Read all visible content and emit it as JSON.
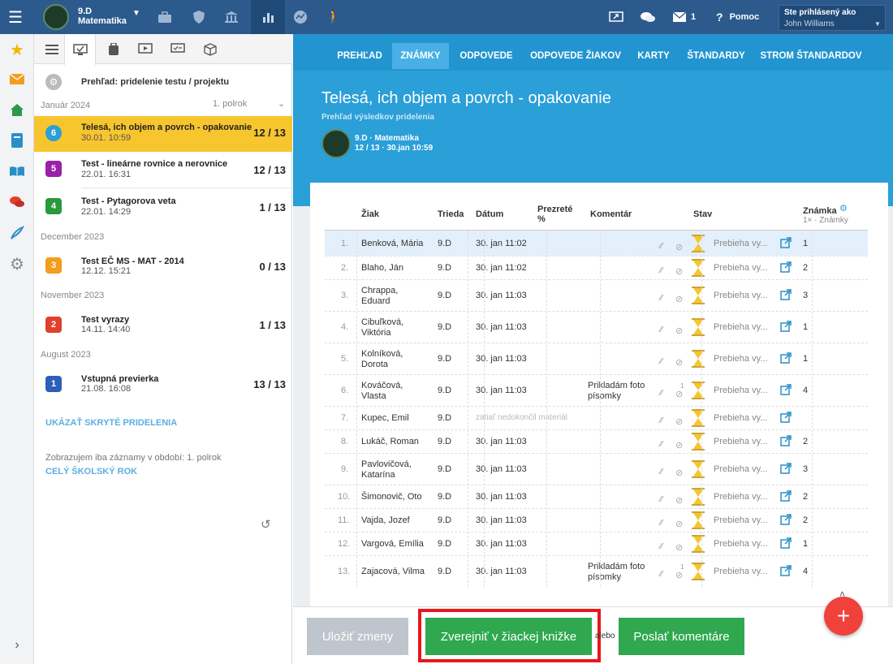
{
  "topbar": {
    "class_name": "9.D",
    "subject": "Matematika",
    "notif_count": "1",
    "help_label": "Pomoc",
    "login_label": "Ste prihlásený ako",
    "user_name": "John Williams"
  },
  "left": {
    "overview_label": "Prehľad: pridelenie testu / projektu",
    "period_label": "1. polrok",
    "months": [
      "Január 2024",
      "December 2023",
      "November 2023",
      "August 2023"
    ],
    "items": [
      {
        "num": "6",
        "title": "Telesá, ich objem a povrch - opakovanie",
        "date": "30.01. 10:59",
        "score": "12 / 13",
        "color": "#2a9fd8"
      },
      {
        "num": "5",
        "title": "Test - lineárne rovnice a nerovnice",
        "date": "22.01. 16:31",
        "score": "12 / 13",
        "color": "#9b1fa8"
      },
      {
        "num": "4",
        "title": "Test - Pytagorova veta",
        "date": "22.01. 14:29",
        "score": "1 / 13",
        "color": "#2a9a3a"
      },
      {
        "num": "3",
        "title": "Test EČ MS - MAT - 2014",
        "date": "12.12. 15:21",
        "score": "0 / 13",
        "color": "#f39c1e"
      },
      {
        "num": "2",
        "title": "Test vyrazy",
        "date": "14.11. 14:40",
        "score": "1 / 13",
        "color": "#e0402c"
      },
      {
        "num": "1",
        "title": "Vstupná previerka",
        "date": "21.08. 16:08",
        "score": "13 / 13",
        "color": "#2c5fb8"
      }
    ],
    "show_hidden": "UKÁZAŤ SKRYTÉ PRIDELENIA",
    "period_note": "Zobrazujem iba záznamy v období: 1. polrok",
    "whole_year": "CELÝ ŠKOLSKÝ ROK"
  },
  "nav": {
    "tabs": [
      "PREHĽAD",
      "ZNÁMKY",
      "ODPOVEDE",
      "ODPOVEDE ŽIAKOV",
      "KARTY",
      "ŠTANDARDY",
      "STROM ŠTANDARDOV"
    ]
  },
  "header": {
    "title": "Telesá, ich objem a povrch - opakovanie",
    "subtitle": "Prehľad výsledkov pridelenia",
    "group": "9.D · Matematika",
    "meta": "12 / 13 · 30.jan 10:59"
  },
  "table": {
    "headers": {
      "student": "Žiak",
      "class": "Trieda",
      "date": "Dátum",
      "viewed": "Prezreté",
      "viewed_pct": "%",
      "comment": "Komentár",
      "status": "Stav",
      "grade": "Známka",
      "grade_sub": "1× · Známky"
    },
    "rows": [
      {
        "n": "1.",
        "name1": "Benková, Mária",
        "name2": "",
        "cls": "9.D",
        "date": "30. jan 11:02",
        "comment1": "",
        "comment2": "",
        "att": "",
        "status": "Prebieha vy...",
        "grade": "1"
      },
      {
        "n": "2.",
        "name1": "Blaho, Ján",
        "name2": "",
        "cls": "9.D",
        "date": "30. jan 11:02",
        "comment1": "",
        "comment2": "",
        "att": "",
        "status": "Prebieha vy...",
        "grade": "2"
      },
      {
        "n": "3.",
        "name1": "Chrappa,",
        "name2": "Eduard",
        "cls": "9.D",
        "date": "30. jan 11:03",
        "comment1": "",
        "comment2": "",
        "att": "",
        "status": "Prebieha vy...",
        "grade": "3"
      },
      {
        "n": "4.",
        "name1": "Cibuľková,",
        "name2": "Viktória",
        "cls": "9.D",
        "date": "30. jan 11:03",
        "comment1": "",
        "comment2": "",
        "att": "",
        "status": "Prebieha vy...",
        "grade": "1"
      },
      {
        "n": "5.",
        "name1": "Kolníková,",
        "name2": "Dorota",
        "cls": "9.D",
        "date": "30. jan 11:03",
        "comment1": "",
        "comment2": "",
        "att": "",
        "status": "Prebieha vy...",
        "grade": "1"
      },
      {
        "n": "6.",
        "name1": "Kováčová,",
        "name2": "Vlasta",
        "cls": "9.D",
        "date": "30. jan 11:03",
        "comment1": "Prikladám foto",
        "comment2": "písomky",
        "att": "1",
        "status": "Prebieha vy...",
        "grade": "4"
      },
      {
        "n": "7.",
        "name1": "Kupec, Emil",
        "name2": "",
        "cls": "9.D",
        "date": "zatiaľ nedokončil materiál",
        "comment1": "",
        "comment2": "",
        "att": "",
        "status": "Prebieha vy...",
        "grade": ""
      },
      {
        "n": "8.",
        "name1": "Lukáč, Roman",
        "name2": "",
        "cls": "9.D",
        "date": "30. jan 11:03",
        "comment1": "",
        "comment2": "",
        "att": "",
        "status": "Prebieha vy...",
        "grade": "2"
      },
      {
        "n": "9.",
        "name1": "Pavlovičová,",
        "name2": "Katarína",
        "cls": "9.D",
        "date": "30. jan 11:03",
        "comment1": "",
        "comment2": "",
        "att": "",
        "status": "Prebieha vy...",
        "grade": "3"
      },
      {
        "n": "10.",
        "name1": "Šimonovič, Oto",
        "name2": "",
        "cls": "9.D",
        "date": "30. jan 11:03",
        "comment1": "",
        "comment2": "",
        "att": "",
        "status": "Prebieha vy...",
        "grade": "2"
      },
      {
        "n": "11.",
        "name1": "Vajda, Jozef",
        "name2": "",
        "cls": "9.D",
        "date": "30. jan 11:03",
        "comment1": "",
        "comment2": "",
        "att": "",
        "status": "Prebieha vy...",
        "grade": "2"
      },
      {
        "n": "12.",
        "name1": "Vargová, Emília",
        "name2": "",
        "cls": "9.D",
        "date": "30. jan 11:03",
        "comment1": "",
        "comment2": "",
        "att": "",
        "status": "Prebieha vy...",
        "grade": "1"
      },
      {
        "n": "13.",
        "name1": "Zajacová, Vilma",
        "name2": "",
        "cls": "9.D",
        "date": "30. jan 11:03",
        "comment1": "Prikladám foto",
        "comment2": "písomky",
        "att": "1",
        "status": "Prebieha vy...",
        "grade": "4"
      }
    ]
  },
  "buttons": {
    "save": "Uložiť zmeny",
    "publish": "Zverejniť v žiackej knižke",
    "or": "alebo",
    "send": "Poslať komentáre",
    "fab": "+"
  },
  "colors": {
    "topbar": "#2c5a8c",
    "nav": "#2295d0",
    "header": "#2a9fd8",
    "selected": "#f7c52e",
    "green": "#2fa84f",
    "highlight": "#e8171b",
    "fab": "#f0413b"
  }
}
